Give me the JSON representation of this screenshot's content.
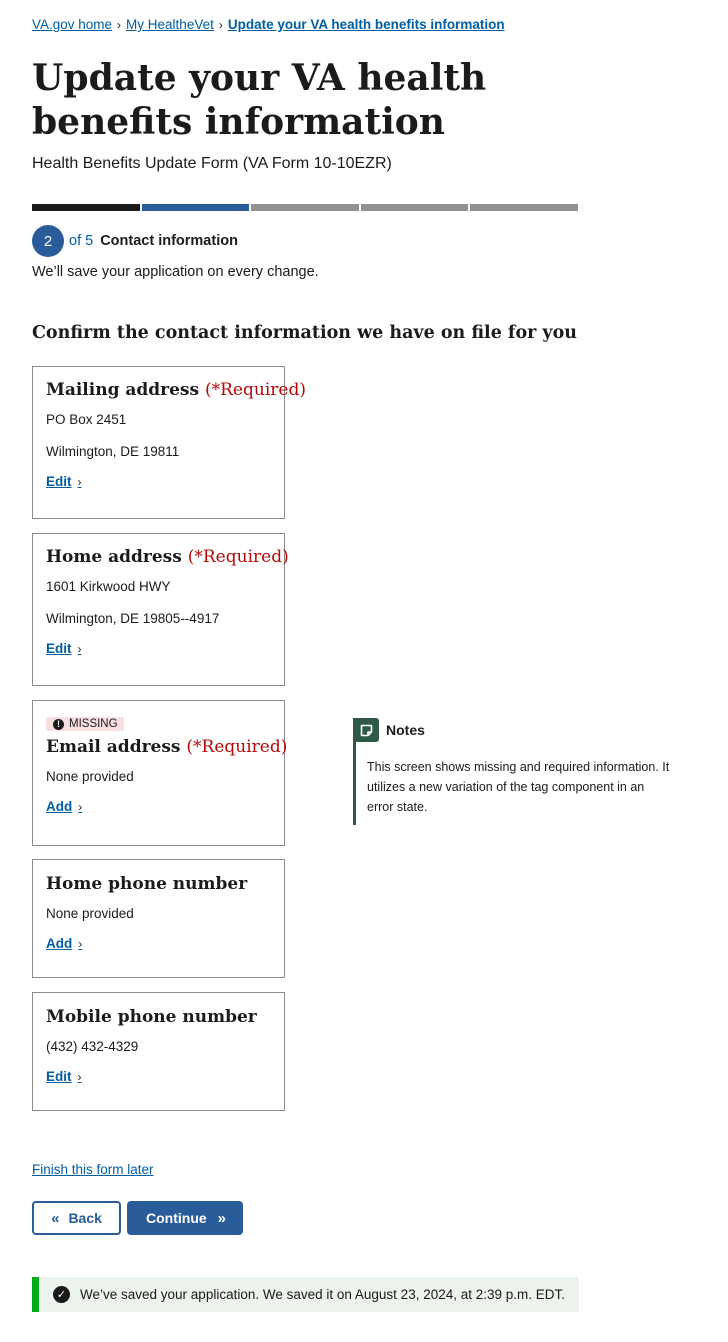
{
  "breadcrumb": {
    "items": [
      "VA.gov home",
      "My HealtheVet",
      "Update your VA health benefits information"
    ]
  },
  "page": {
    "title": "Update your VA health benefits information",
    "subtitle": "Health Benefits Update Form (VA Form 10-10EZR)"
  },
  "progress": {
    "total_segments": 5,
    "completed": 1,
    "current_step": 2,
    "step_number": "2",
    "of_text": "of 5",
    "step_label": "Contact information",
    "save_note": "We’ll save your application on every change."
  },
  "contact": {
    "heading": "Confirm the contact information we have on file for you",
    "cards": [
      {
        "title": "Mailing address",
        "required": "(*Required)",
        "lines": [
          "PO Box 2451",
          "Wilmington, DE 19811"
        ],
        "action": "Edit"
      },
      {
        "title": "Home address",
        "required": "(*Required)",
        "lines": [
          "1601 Kirkwood HWY",
          "Wilmington, DE 19805--4917"
        ],
        "action": "Edit"
      },
      {
        "title": "Email address",
        "required": "(*Required)",
        "tag": "MISSING",
        "lines": [
          "None provided"
        ],
        "action": "Add"
      },
      {
        "title": "Home phone number",
        "lines": [
          "None provided"
        ],
        "action": "Add"
      },
      {
        "title": "Mobile phone number",
        "lines": [
          "(432) 432-4329"
        ],
        "action": "Edit"
      }
    ]
  },
  "notes": {
    "title": "Notes",
    "body": "This screen shows missing and required information. It utilizes a new variation of the tag component in an error state."
  },
  "actions": {
    "finish_later": "Finish this form later",
    "back": "Back",
    "continue": "Continue"
  },
  "alert": {
    "text": "We’ve saved your application. We saved it on August 23, 2024, at 2:39 p.m. EDT."
  },
  "colors": {
    "primary": "#2a5c9a",
    "link": "#005ea2",
    "required": "#b50909",
    "tag_bg": "#f8dfe2",
    "notes_accent": "#2e5a43",
    "success_border": "#00a91c",
    "success_bg": "#ecf3ec"
  },
  "icons": {
    "breadcrumb_separator": "chevron-right-icon",
    "tag": "exclamation-circle-icon",
    "notes": "note-icon",
    "back": "double-chevron-left-icon",
    "continue": "double-chevron-right-icon",
    "alert": "check-circle-icon"
  }
}
